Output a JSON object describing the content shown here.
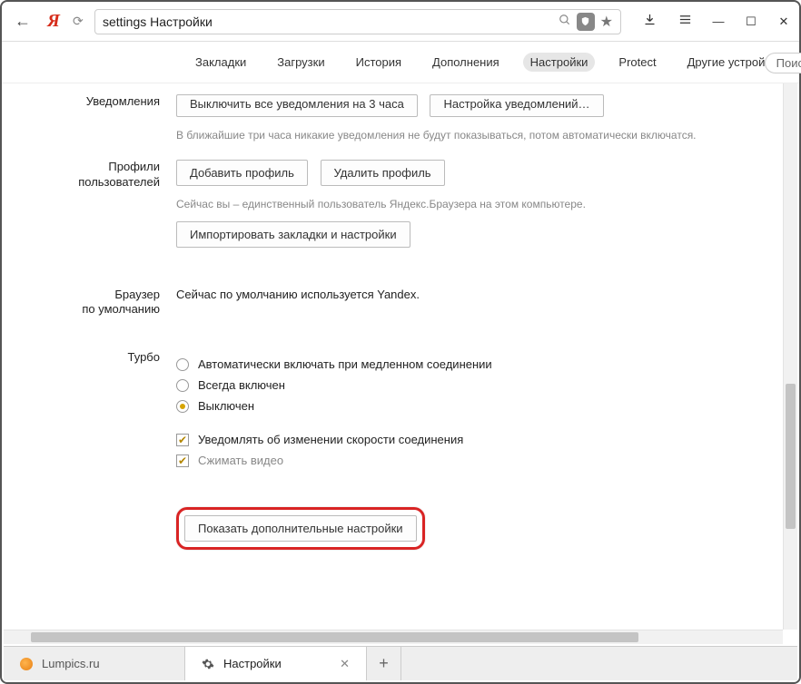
{
  "addressbar": {
    "url_key": "settings",
    "url_title": "Настройки"
  },
  "nav": {
    "items": [
      {
        "label": "Закладки"
      },
      {
        "label": "Загрузки"
      },
      {
        "label": "История"
      },
      {
        "label": "Дополнения"
      },
      {
        "label": "Настройки",
        "active": true
      },
      {
        "label": "Protect"
      },
      {
        "label": "Другие устройства"
      }
    ],
    "search_placeholder": "Поис"
  },
  "sections": {
    "notifications": {
      "label": "Уведомления",
      "btn_mute": "Выключить все уведомления на 3 часа",
      "btn_config": "Настройка уведомлений…",
      "note": "В ближайшие три часа никакие уведомления не будут показываться, потом автоматически включатся."
    },
    "profiles": {
      "label_line1": "Профили",
      "label_line2": "пользователей",
      "btn_add": "Добавить профиль",
      "btn_del": "Удалить профиль",
      "note": "Сейчас вы – единственный пользователь Яндекс.Браузера на этом компьютере.",
      "btn_import": "Импортировать закладки и настройки"
    },
    "default_browser": {
      "label_line1": "Браузер",
      "label_line2": "по умолчанию",
      "text": "Сейчас по умолчанию используется Yandex."
    },
    "turbo": {
      "label": "Турбо",
      "opt_auto": "Автоматически включать при медленном соединении",
      "opt_on": "Всегда включен",
      "opt_off": "Выключен",
      "chk_notify": "Уведомлять об изменении скорости соединения",
      "chk_video": "Сжимать видео"
    },
    "advanced": {
      "btn": "Показать дополнительные настройки"
    }
  },
  "tabs": [
    {
      "title": "Lumpics.ru",
      "favicon": "orange"
    },
    {
      "title": "Настройки",
      "favicon": "gear",
      "active": true
    }
  ]
}
